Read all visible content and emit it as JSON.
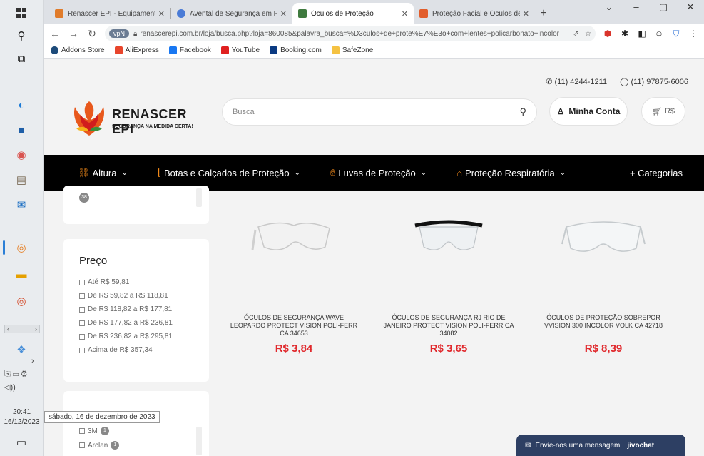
{
  "taskbar": {
    "time": "20:41",
    "date": "16/12/2023",
    "tooltip": "sábado, 16 de dezembro de 2023"
  },
  "browser": {
    "tabs": [
      {
        "title": "Renascer EPI - Equipamentos de",
        "color": "#e07b2a"
      },
      {
        "title": "Avental de Segurança em PVC",
        "color": "#4a7bd6"
      },
      {
        "title": "Óculos de Proteção",
        "color": "#3f7a3f"
      },
      {
        "title": "Proteção Facial e Óculos de Pro",
        "color": "#e25d2b"
      }
    ],
    "active_tab_index": 2,
    "url_badge": "vpN",
    "url": "renascerepi.com.br/loja/busca.php?loja=860085&palavra_busca=%D3culos+de+prote%E7%E3o+com+lentes+policarbonato+incolor",
    "bookmarks": [
      "Addons Store",
      "AliExpress",
      "Facebook",
      "YouTube",
      "Booking.com",
      "SafeZone"
    ]
  },
  "site": {
    "phone1": "(11) 4244-1211",
    "phone2": "(11) 97875-6006",
    "logo_title": "RENASCER EPI",
    "logo_sub": "SEGURANÇA NA MEDIDA CERTA!",
    "search_placeholder": "Busca",
    "account_label": "Minha Conta",
    "cart_label": "R$",
    "nav": [
      {
        "label": "Altura",
        "icon": "harness-icon"
      },
      {
        "label": "Botas e Calçados de Proteção",
        "icon": "boot-icon"
      },
      {
        "label": "Luvas de Proteção",
        "icon": "glove-icon"
      },
      {
        "label": "Proteção Respiratória",
        "icon": "mask-icon"
      }
    ],
    "nav_more": "+ Categorias",
    "filter_count_top": "38",
    "price_title": "Preço",
    "price_options": [
      "Até R$ 59,81",
      "De R$ 59,82 a R$ 118,81",
      "De R$ 118,82 a R$ 177,81",
      "De R$ 177,82 a R$ 236,81",
      "De R$ 236,82 a R$ 295,81",
      "Acima de R$ 357,34"
    ],
    "brands": [
      {
        "name": "3M",
        "count": "1"
      },
      {
        "name": "Arclan",
        "count": "1"
      }
    ],
    "products": [
      {
        "name": "ÓCULOS DE SEGURANÇA WAVE LEOPARDO PROTECT VISION POLI-FERR CA 34653",
        "price": "R$ 3,84"
      },
      {
        "name": "ÓCULOS DE SEGURANÇA RJ RIO DE JANEIRO PROTECT VISION POLI-FERR CA 34082",
        "price": "R$ 3,65"
      },
      {
        "name": "ÓCULOS DE PROTEÇÃO SOBREPOR VVISION 300 INCOLOR VOLK CA 42718",
        "price": "R$ 8,39"
      }
    ],
    "chat_label": "Envie-nos uma mensagem",
    "chat_brand": "jivochat"
  },
  "colors": {
    "accent": "#e0282c",
    "nav_bg": "#000000",
    "nav_icon": "#f28a1a",
    "chat_bg": "#2d3f63"
  }
}
